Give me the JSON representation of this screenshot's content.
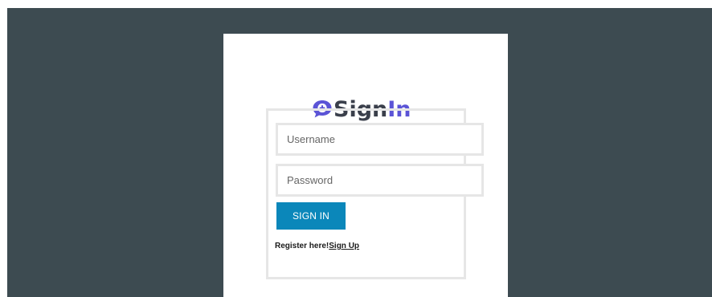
{
  "logo": {
    "icon": "chat-plus-icon",
    "text_sign": "Sign",
    "text_in": "In",
    "sign_color": "#3a3f4b",
    "in_color": "#5b54d6"
  },
  "form": {
    "username_placeholder": "Username",
    "password_placeholder": "Password",
    "submit_label": "SIGN IN",
    "submit_color": "#0b87ba"
  },
  "register": {
    "prompt": "Register here!",
    "link_label": "Sign Up"
  },
  "colors": {
    "backdrop": "#3d4b51",
    "card": "#ffffff",
    "field_border": "#e6e6e6"
  }
}
